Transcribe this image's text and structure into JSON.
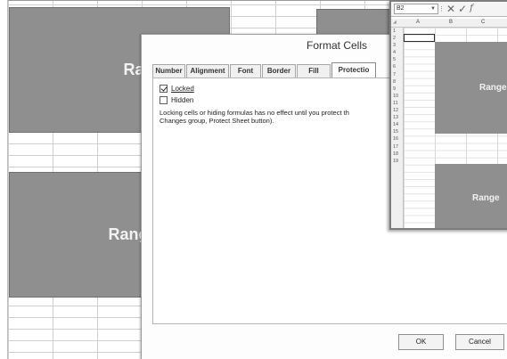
{
  "worksheet": {
    "range_top_left": "Range for J",
    "range_bottom_left": "Range for G"
  },
  "dialog": {
    "title": "Format Cells",
    "tabs": [
      {
        "label": "Number"
      },
      {
        "label": "Alignment"
      },
      {
        "label": "Font"
      },
      {
        "label": "Border"
      },
      {
        "label": "Fill"
      },
      {
        "label": "Protectio"
      }
    ],
    "active_tab": "Protection",
    "locked_label": "Locked",
    "locked_checked": true,
    "hidden_label": "Hidden",
    "hidden_checked": false,
    "info_text": "Locking cells or hiding formulas has no effect until you protect th\nChanges group, Protect Sheet button).",
    "ok_label": "OK",
    "cancel_label": "Cancel"
  },
  "mini_window": {
    "name_box": "B2",
    "columns": [
      "A",
      "B",
      "C"
    ],
    "rows": [
      "1",
      "2",
      "3",
      "4",
      "5",
      "6",
      "7",
      "8",
      "9",
      "10",
      "11",
      "12",
      "13",
      "14",
      "15",
      "16",
      "17",
      "18",
      "19"
    ],
    "range_1_label": "Range",
    "range_2_label": "Range"
  },
  "colors": {
    "range_fill": "#8f8f8f",
    "range_text": "#f2f2f2",
    "dialog_bg": "#fdfdfd"
  }
}
